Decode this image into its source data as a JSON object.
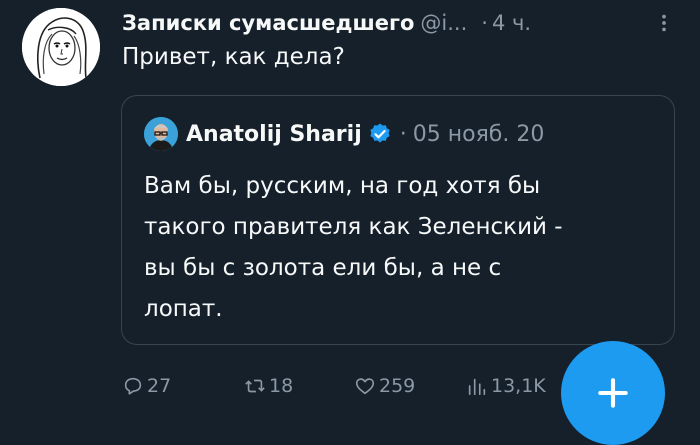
{
  "tweet": {
    "author_name": "Записки сумасшедшего",
    "author_handle": "@i...",
    "separator": "·",
    "time": "4 ч.",
    "text": "Привет, как дела?",
    "avatar_icon": "sketch-portrait-avatar",
    "more_icon": "more-vertical-icon"
  },
  "quote": {
    "author_name": "Anatolij Sharij",
    "verified": true,
    "separator": "·",
    "date": "05 нояб. 20",
    "text_lines": [
      "Вам бы, русским, на год хотя бы",
      "такого правителя как Зеленский -",
      "вы бы с золота ели бы, а не с",
      "лопат."
    ]
  },
  "actions": {
    "replies": "27",
    "retweets": "18",
    "likes": "259",
    "views": "13,1K"
  },
  "colors": {
    "background": "#15202b",
    "text": "#f7f9f9",
    "muted": "#8b98a5",
    "accent": "#1d9bf0",
    "border": "#38444d"
  }
}
